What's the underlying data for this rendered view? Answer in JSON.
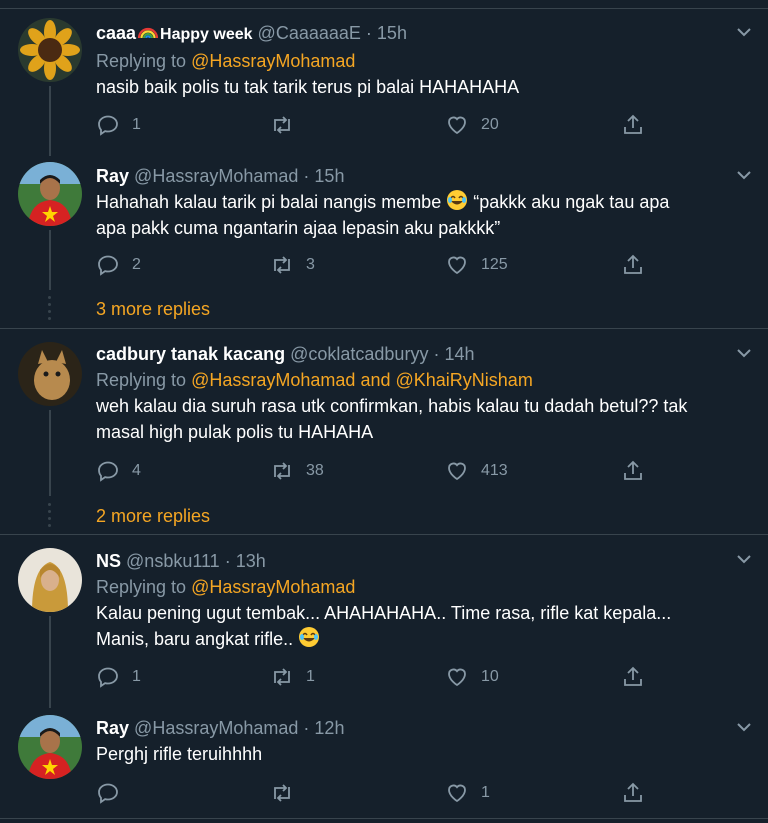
{
  "tweets": [
    {
      "name": "caaa",
      "name_suffix": "Happy week",
      "handle": "@CaaaaaaE",
      "time": "15h",
      "replying_label": "Replying to",
      "replying_to": "@HassrayMohamad",
      "replying_to_2": "",
      "text": "nasib baik polis tu tak tarik terus pi balai HAHAHAHA",
      "text_2": "",
      "replies": "1",
      "retweets": "",
      "likes": "20"
    },
    {
      "name": "Ray",
      "handle": "@HassrayMohamad",
      "time": "15h",
      "text": "Hahahah kalau tarik pi balai nangis membe",
      "text_after_emoji": " “pakkk aku ngak tau apa",
      "text_2": "apa pakk cuma ngantarin ajaa lepasin aku pakkkk”",
      "replies": "2",
      "retweets": "3",
      "likes": "125",
      "more_replies": "3 more replies"
    },
    {
      "name": "cadbury tanak kacang",
      "handle": "@coklatcadburyy",
      "time": "14h",
      "replying_label": "Replying to",
      "replying_to": "@HassrayMohamad",
      "replying_and": "and",
      "replying_to_2": "@KhaiRyNisham",
      "text": "weh kalau dia suruh rasa utk confirmkan, habis kalau tu dadah betul?? tak",
      "text_2": "masal high pulak polis tu HAHAHA",
      "replies": "4",
      "retweets": "38",
      "likes": "413",
      "more_replies": "2 more replies"
    },
    {
      "name": "NS",
      "handle": "@nsbku111",
      "time": "13h",
      "replying_label": "Replying to",
      "replying_to": "@HassrayMohamad",
      "text": "Kalau pening ugut tembak... AHAHAHAHA.. Time rasa, rifle kat kepala...",
      "text_2": "Manis, baru angkat rifle..",
      "replies": "1",
      "retweets": "1",
      "likes": "10"
    },
    {
      "name": "Ray",
      "handle": "@HassrayMohamad",
      "time": "12h",
      "text": "Perghj rifle teruihhhh",
      "replies": "",
      "retweets": "",
      "likes": "1"
    }
  ],
  "dot_sep": "·",
  "icons": {
    "reply": "reply-icon",
    "retweet": "retweet-icon",
    "like": "heart-icon",
    "share": "share-icon",
    "more": "chevron-down-icon",
    "emoji_laugh": "tears-of-joy-emoji",
    "emoji_rainbow": "rainbow-emoji"
  },
  "colors": {
    "background": "#15202b",
    "mention": "#f5a623",
    "muted": "#8899a6",
    "divider": "#38444d"
  }
}
